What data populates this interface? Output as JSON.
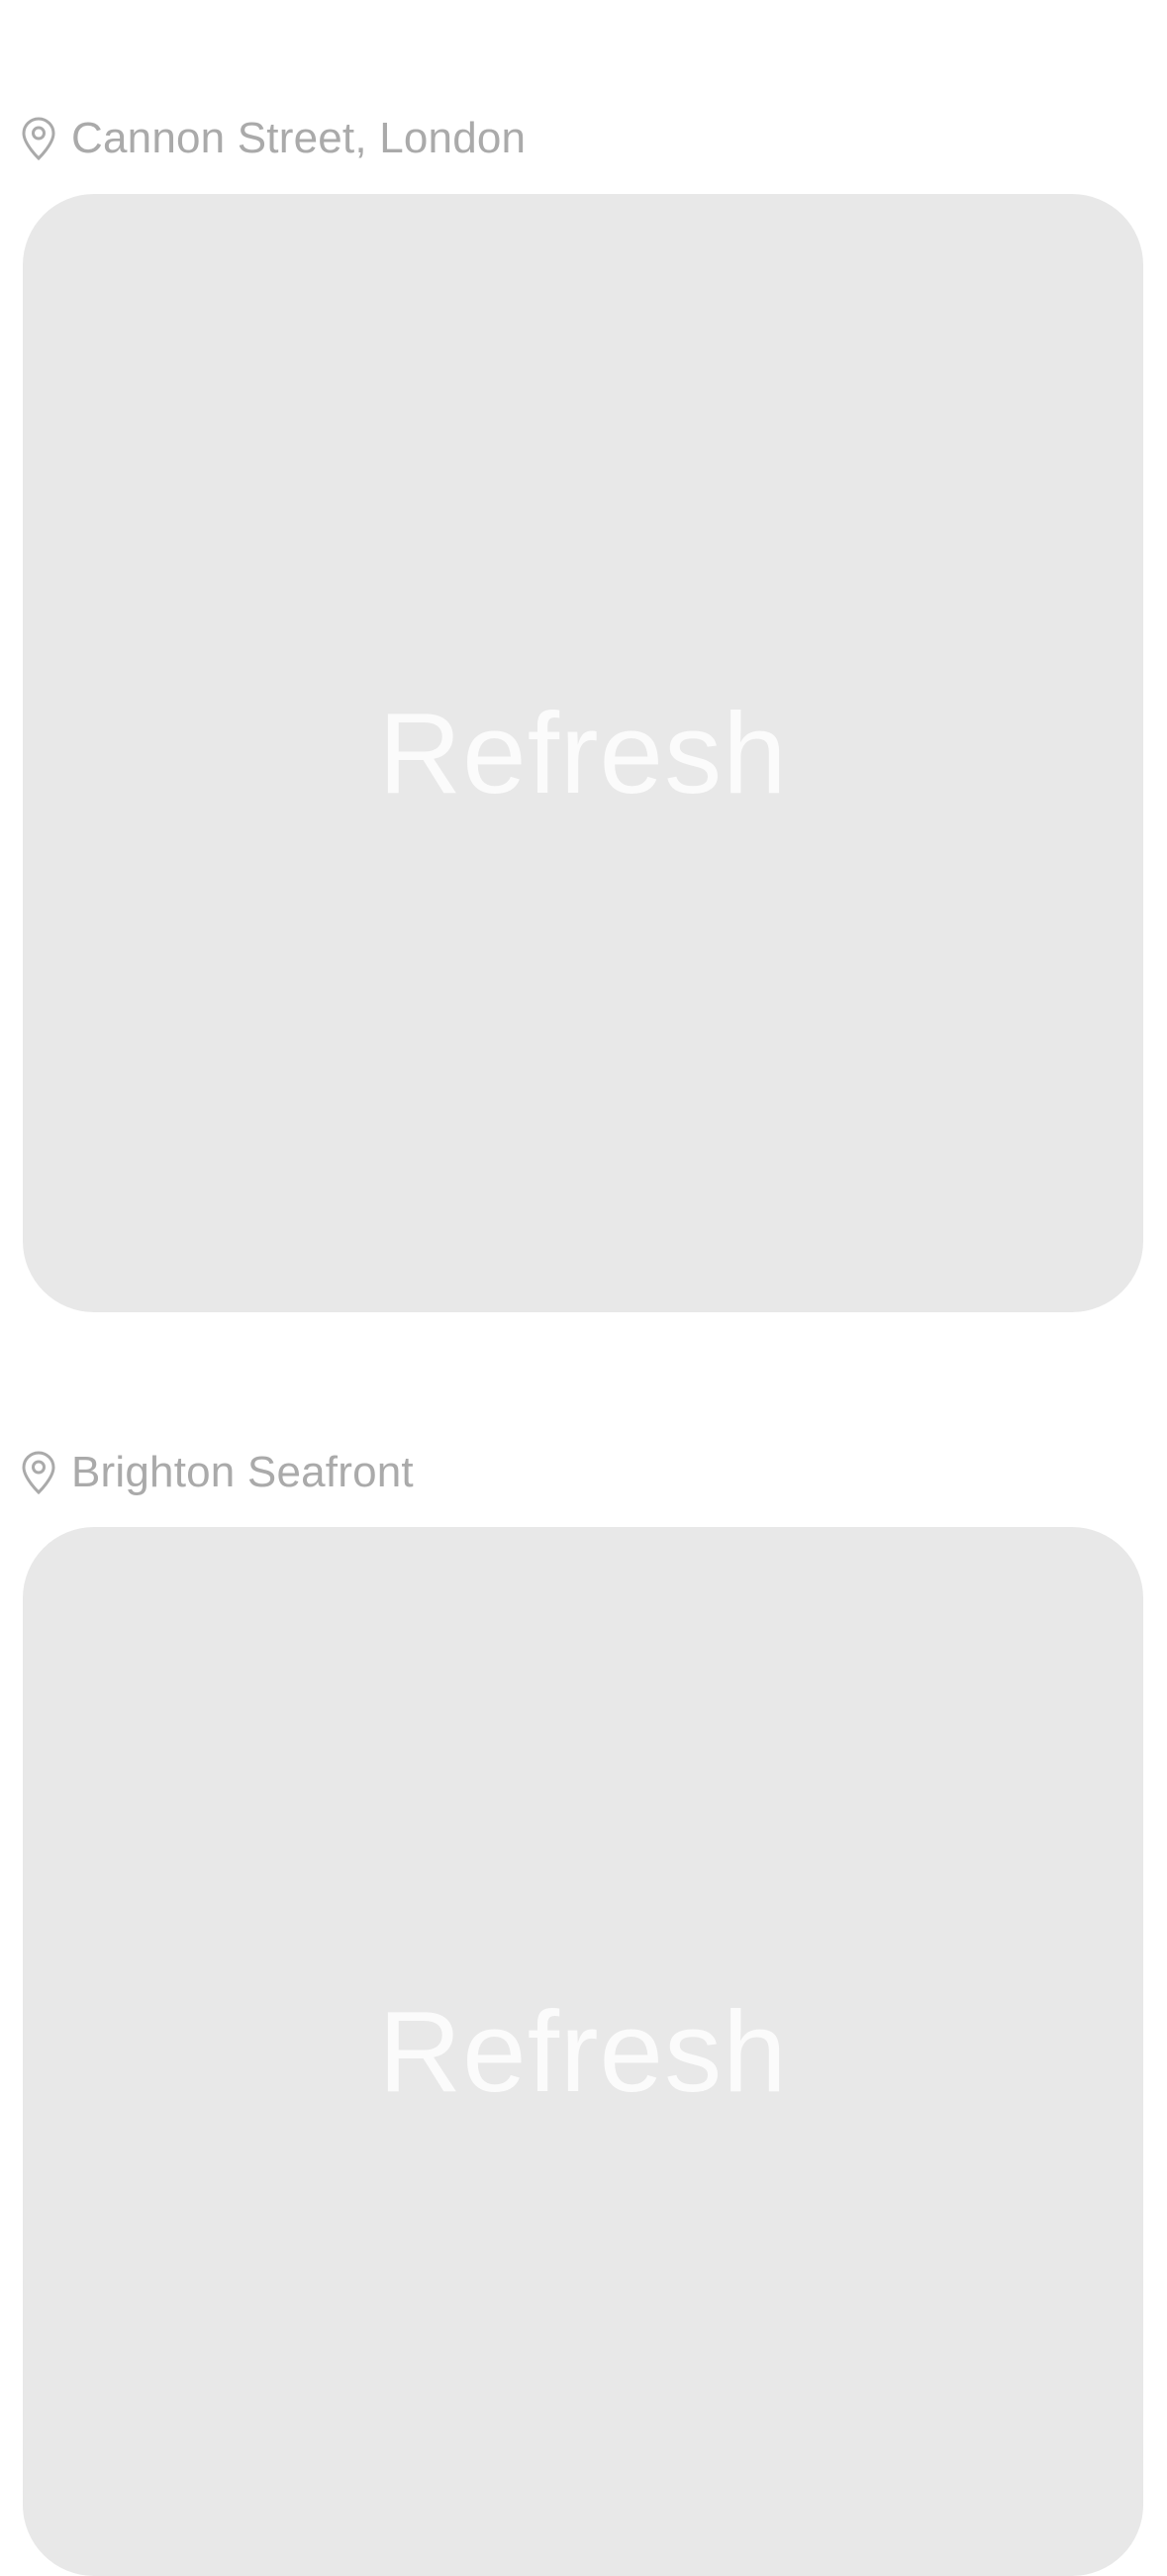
{
  "feed": {
    "items": [
      {
        "location_icon": "location-pin-icon",
        "location": "Cannon Street, London",
        "action_label": "Refresh"
      },
      {
        "location_icon": "location-pin-icon",
        "location": "Brighton Seafront",
        "action_label": "Refresh"
      }
    ]
  },
  "colors": {
    "background": "#ffffff",
    "card": "#e8e8e8",
    "location_text": "#aaaaaa",
    "refresh_text": "#fbfbfb"
  }
}
